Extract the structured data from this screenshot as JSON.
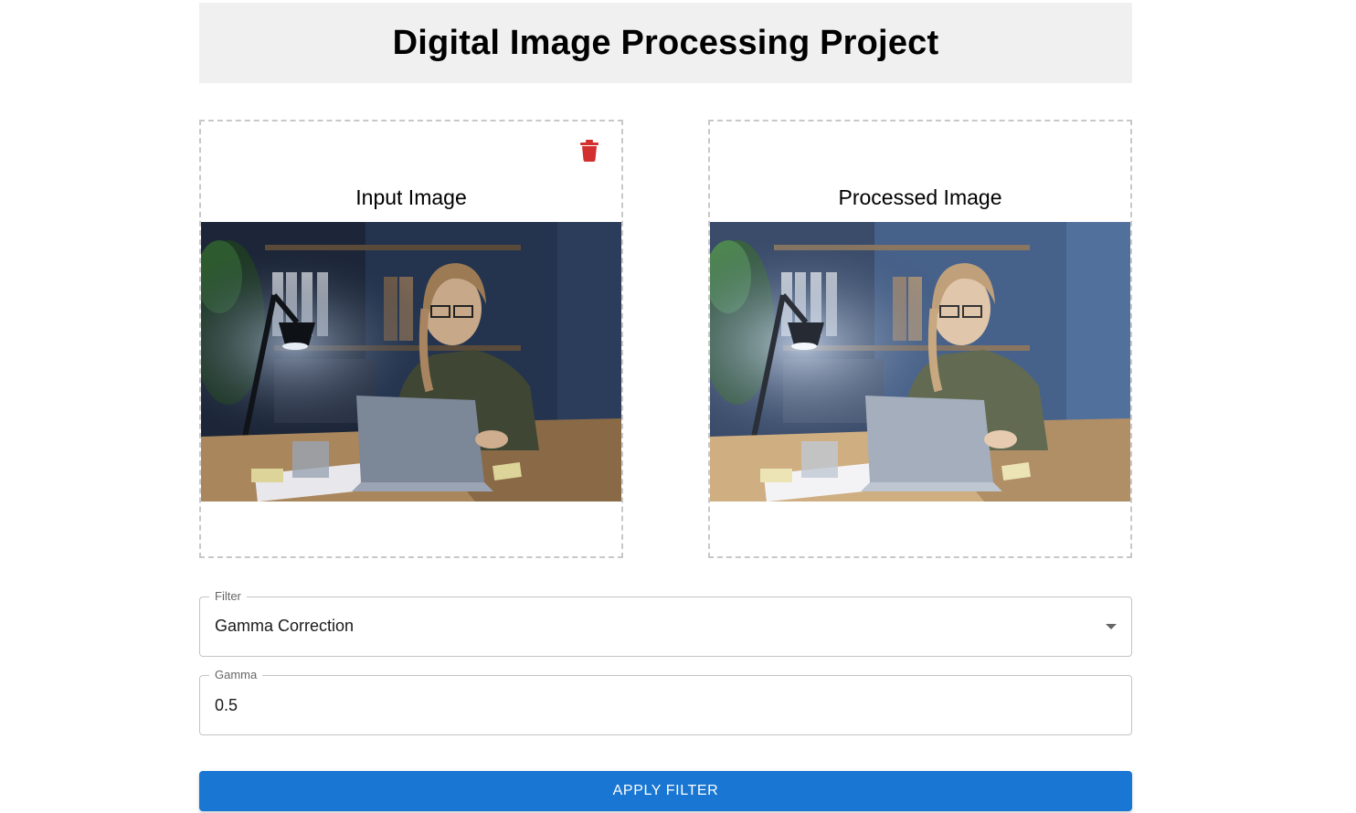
{
  "header": {
    "title": "Digital Image Processing Project"
  },
  "input_panel": {
    "title": "Input Image",
    "delete_icon": "trash-icon"
  },
  "output_panel": {
    "title": "Processed Image"
  },
  "filter": {
    "label": "Filter",
    "value": "Gamma Correction"
  },
  "gamma": {
    "label": "Gamma",
    "value": "0.5"
  },
  "apply_button": {
    "label": "APPLY FILTER"
  },
  "colors": {
    "accent": "#1976d2",
    "delete": "#d32f2f",
    "header_bg": "#f0f0f0"
  }
}
